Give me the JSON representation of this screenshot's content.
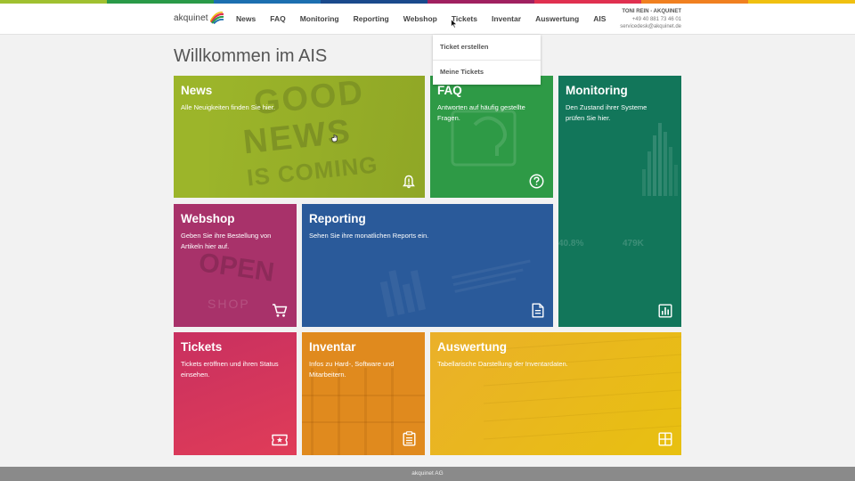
{
  "header": {
    "logo_text": "akquinet",
    "nav": [
      "News",
      "FAQ",
      "Monitoring",
      "Reporting",
      "Webshop",
      "Tickets",
      "Inventar",
      "Auswertung",
      "AIS"
    ],
    "user": {
      "name": "TONI REIN - AKQUINET",
      "phone": "+49 40 881 73 46 01",
      "email": "servicedesk@akquinet.de"
    }
  },
  "dropdown": {
    "items": [
      "Ticket erstellen",
      "Meine Tickets"
    ]
  },
  "page_title": "Willkommen im AIS",
  "tiles": {
    "news": {
      "title": "News",
      "desc": "Alle Neuigkeiten finden Sie hier.",
      "bg_words": [
        "GOOD",
        "NEWS",
        "IS COMING"
      ]
    },
    "faq": {
      "title": "FAQ",
      "desc": "Antworten auf häufig gestellte Fragen."
    },
    "monitoring": {
      "title": "Monitoring",
      "desc": "Den Zustand ihrer Systeme prüfen Sie hier.",
      "bg_values": [
        "40.8%",
        "479K"
      ]
    },
    "webshop": {
      "title": "Webshop",
      "desc": "Geben Sie ihre Bestellung von Artikeln hier auf.",
      "bg_words": [
        "OPEN",
        "SHOP"
      ]
    },
    "reporting": {
      "title": "Reporting",
      "desc": "Sehen Sie ihre monatlichen Reports ein."
    },
    "tickets": {
      "title": "Tickets",
      "desc": "Tickets eröffnen und ihren Status einsehen."
    },
    "inventar": {
      "title": "Inventar",
      "desc": "Infos zu Hard-, Software und Mitarbeitern."
    },
    "auswertung": {
      "title": "Auswertung",
      "desc": "Tabellarische Darstellung der Inventardaten."
    }
  },
  "footer": {
    "text": "akquinet AG"
  },
  "colors": {
    "news": "#9cb52a",
    "faq": "#2e9a46",
    "monitoring": "#12765a",
    "webshop": "#a8326a",
    "reporting": "#2a5a9a",
    "tickets": "#d93c5c",
    "inventar": "#e08a1e",
    "auswertung": "#e8b810",
    "topbar": [
      "#a0c030",
      "#2a9a48",
      "#1c6fb0",
      "#1a4a8c",
      "#a02060",
      "#e03050",
      "#f08020",
      "#f0c010"
    ]
  }
}
